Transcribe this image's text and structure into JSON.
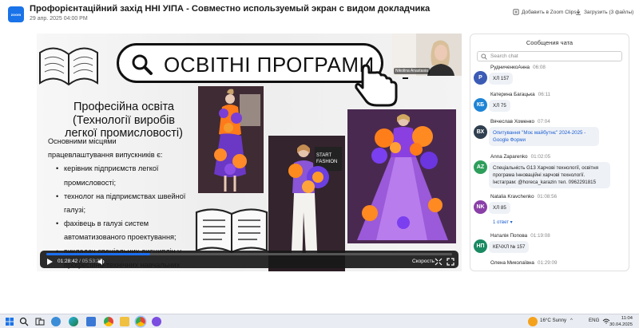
{
  "header": {
    "logo_text": "zoom",
    "title": "Профорієнтаційний захід ННІ УІПА - Совместно используемый экран с видом докладчика",
    "subtitle": "29 апр. 2025 04:00 PM",
    "add_clips_label": "Добавить в Zoom Clips",
    "download_label": "Загрузить (3 файлы)"
  },
  "slide": {
    "banner": "ОСВІТНІ ПРОГРАМИ",
    "heading_lines": [
      "Професійна освіта",
      "(Технології виробів",
      "легкої промисловості)"
    ],
    "intro_lines": [
      "Основними місцями",
      "працевлаштування випускників є:"
    ],
    "bullets": [
      "керівник підприємств легкої промисловості;",
      "технолог на підприємствах швейної галузі;",
      "фахівець в галузі систем автоматизованого проектування;",
      "викладач спеціальних дисциплін у професійно-технічних навчальних закладах, технікумах, коледжах, а також у закладах вищої"
    ],
    "photo_sign": "START FASHION"
  },
  "camera": {
    "name_label": "Nikolina Anastasia"
  },
  "player": {
    "progress": 0.2565,
    "current_time": "01:28:42",
    "total_time": "/ 05:53:25",
    "speed_label": "Скорость"
  },
  "chat": {
    "title": "Сообщения чата",
    "search_placeholder": "Search chat",
    "messages": [
      {
        "initials": "P",
        "color": "#3b5bb5",
        "sender": "РудниченкоАнна",
        "time": "06:08",
        "text": "ХЛ 157"
      },
      {
        "initials": "КБ",
        "color": "#1d84d6",
        "sender": "Катерина Багацька",
        "time": "06:11",
        "text": "ХЛ 75"
      },
      {
        "initials": "ВХ",
        "color": "#2f3f4f",
        "sender": "Вячеслав Хоменко",
        "time": "07:04",
        "text": "Опитування \"Моє майбутнє\" 2024-2025 - Google Форми"
      },
      {
        "initials": "AZ",
        "color": "#2e9e5b",
        "sender": "Anna Zaparenko",
        "time": "01:02:05",
        "text": "Спеціальність G13 Харчові технології, освітня програма Інноваційні харчові технології. Інстаграм: @horeca_karazin тел. 0962291815"
      },
      {
        "initials": "NK",
        "color": "#8a3fa8",
        "sender": "Natalia Kravchenko",
        "time": "01:08:56",
        "text": "ХЛ 85",
        "replies": "1 ответ ▾"
      },
      {
        "initials": "НП",
        "color": "#1a8a62",
        "sender": "Наталія Попова",
        "time": "01:19:08",
        "text": "КЕЧХЛ № 157"
      },
      {
        "initials": "",
        "color": "#bdbdbd",
        "sender": "Олена Миколаївна",
        "time": "01:29:09",
        "text": ""
      }
    ]
  },
  "taskbar": {
    "weather": "16°C  Sunny",
    "lang": "ENG",
    "time": "11:04",
    "date": "30.04.2025"
  }
}
